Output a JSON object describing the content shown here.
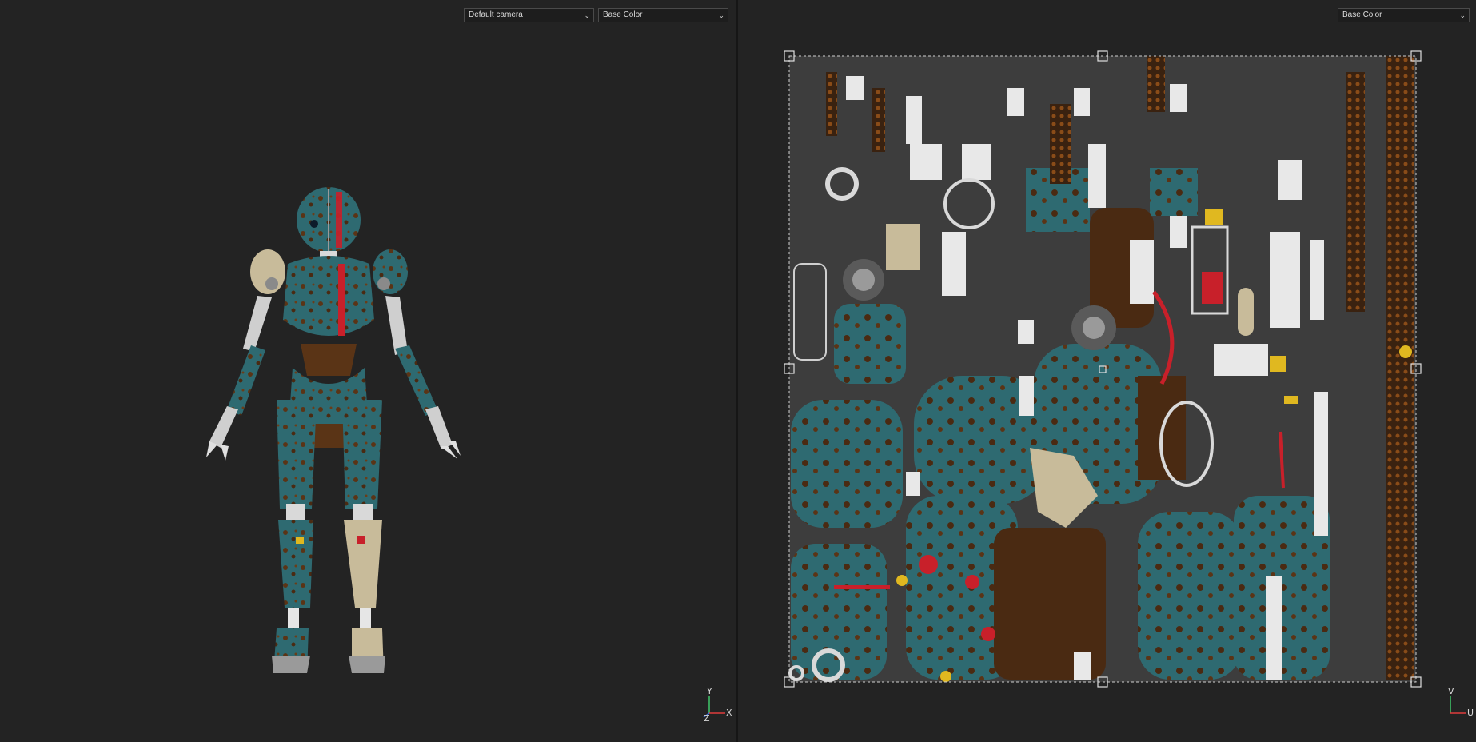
{
  "viewport_3d": {
    "camera_select": "Default camera",
    "channel_select": "Base Color",
    "gizmo": {
      "y": "Y",
      "x": "X",
      "z": "Z"
    }
  },
  "viewport_uv": {
    "channel_select": "Base Color",
    "gizmo": {
      "v": "V",
      "u": "U"
    }
  },
  "colors": {
    "background": "#232323",
    "teal": "#2e6a71",
    "rust": "#5a3416",
    "beige": "#c8bb9a",
    "metal_light": "#cfcfcf",
    "uv_background": "#3d3d3d",
    "accent_red": "#c8202a",
    "accent_yellow": "#e0b820"
  }
}
